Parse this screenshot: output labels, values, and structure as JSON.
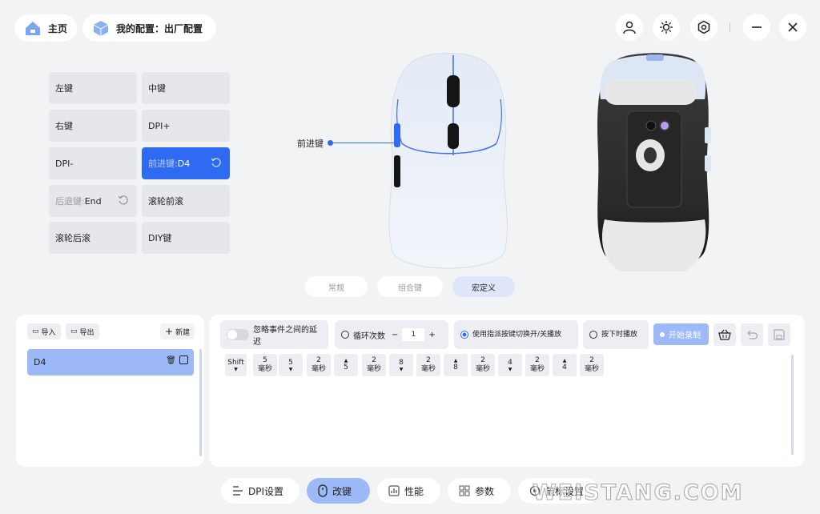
{
  "header": {
    "home_label": "主页",
    "profile_label": "我的配置：出厂配置",
    "icons": [
      "user-icon",
      "sun-icon",
      "settings-hex-icon",
      "minimize-icon",
      "close-icon"
    ]
  },
  "keys": [
    {
      "label": "左键"
    },
    {
      "label": "中键"
    },
    {
      "label": "右键"
    },
    {
      "label": "DPI+"
    },
    {
      "label": "DPI-"
    },
    {
      "prefix": "前进键:",
      "value": "D4",
      "active": true
    },
    {
      "prefix": "后退键:",
      "value": "End"
    },
    {
      "label": "滚轮前滚"
    },
    {
      "label": "滚轮后滚"
    },
    {
      "label": "DIY键"
    }
  ],
  "callout": "前进键",
  "mode_tabs": [
    "常规",
    "组合键",
    "宏定义"
  ],
  "mode_selected": "宏定义",
  "macro_list": {
    "import": "导入",
    "export": "导出",
    "new": "新建",
    "items": [
      "D4"
    ]
  },
  "editor": {
    "ignore_delay": "忽略事件之间的延迟",
    "loop_label": "循环次数",
    "loop_value": "1",
    "toggle_label": "使用指派按键切换开/关播放",
    "hold_label": "按下时播放",
    "record_label": "开始录制"
  },
  "macro_seq": [
    {
      "t": "Shift",
      "a": "down"
    },
    {
      "t": "5",
      "s": "毫秒"
    },
    {
      "t": "5",
      "a": "down"
    },
    {
      "t": "2",
      "s": "毫秒"
    },
    {
      "t": "5",
      "a": "up"
    },
    {
      "t": "2",
      "s": "毫秒"
    },
    {
      "t": "8",
      "a": "down"
    },
    {
      "t": "2",
      "s": "毫秒"
    },
    {
      "t": "8",
      "a": "up"
    },
    {
      "t": "2",
      "s": "毫秒"
    },
    {
      "t": "4",
      "a": "down"
    },
    {
      "t": "2",
      "s": "毫秒"
    },
    {
      "t": "4",
      "a": "up"
    },
    {
      "t": "2",
      "s": "毫秒"
    }
  ],
  "bottom_nav": [
    "DPI设置",
    "改键",
    "性能",
    "参数",
    "鼠标设置"
  ],
  "bottom_nav_selected": "改键",
  "watermark": "WEISTANG.COM",
  "colors": {
    "accent": "#2f6bf2",
    "accent_light": "#9db9f7"
  }
}
